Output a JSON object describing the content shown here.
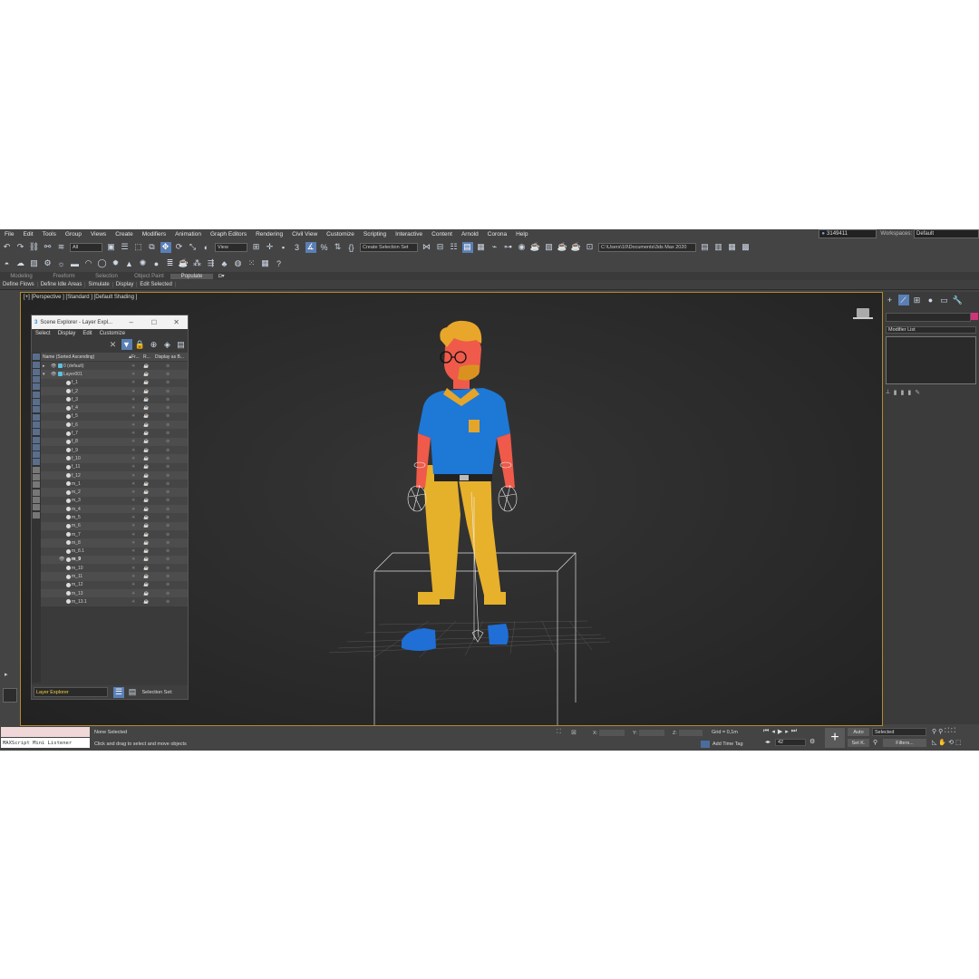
{
  "menu": [
    "File",
    "Edit",
    "Tools",
    "Group",
    "Views",
    "Create",
    "Modifiers",
    "Animation",
    "Graph Editors",
    "Rendering",
    "Civil View",
    "Customize",
    "Scripting",
    "Interactive",
    "Content",
    "Arnold",
    "Corona",
    "Help"
  ],
  "user": "3149411",
  "workspaces_label": "Workspaces:",
  "workspace_value": "Default",
  "toolbar": {
    "filter": "All",
    "view": "View",
    "create_selection_set": "Create Selection Set",
    "path": "C:\\Users\\10\\Documents\\3ds Max 2020"
  },
  "ribbon_tabs": [
    "Modeling",
    "Freeform",
    "Selection",
    "Object Paint",
    "Populate"
  ],
  "ribbon_items": [
    "Define Flows",
    "Define Idle Areas",
    "Simulate",
    "Display",
    "Edit Selected"
  ],
  "viewport_label": "[+] [Perspective ] [Standard ] [Default Shading ]",
  "scene_explorer": {
    "title": "Scene Explorer - Layer Expl...",
    "menu": [
      "Select",
      "Display",
      "Edit",
      "Customize"
    ],
    "columns": [
      "Name (Sorted Ascending)",
      "Fr...",
      "R...",
      "Display as B..."
    ],
    "layers": [
      "0 (default)",
      "Layer001"
    ],
    "objects": [
      "f_1",
      "f_2",
      "f_3",
      "f_4",
      "f_5",
      "f_6",
      "f_7",
      "f_8",
      "f_9",
      "f_10",
      "f_11",
      "f_12",
      "m_1",
      "m_2",
      "m_3",
      "m_4",
      "m_5",
      "m_6",
      "m_7",
      "m_8",
      "m_8.1",
      "m_9",
      "m_10",
      "m_11",
      "m_12",
      "m_13",
      "m_13.1"
    ],
    "footer_left": "Layer Explorer",
    "footer_right": "Selection Set:"
  },
  "right_panel": {
    "modifier_list": "Modifier List"
  },
  "status": {
    "maxscript": "MAXScript Mini Listener",
    "selected": "None Selected",
    "prompt": "Click and drag to select and move objects",
    "x_label": "X:",
    "y_label": "Y:",
    "z_label": "Z:",
    "grid": "Grid = 0,1m",
    "add_time_tag": "Add Time Tag",
    "auto": "Auto",
    "selected_dd": "Selected",
    "set_key": "Set K.",
    "filters": "Filters...",
    "frame": "42"
  },
  "accent_colors": {
    "viewport_border": "#b08b2e",
    "highlight": "#5a7fb4"
  }
}
